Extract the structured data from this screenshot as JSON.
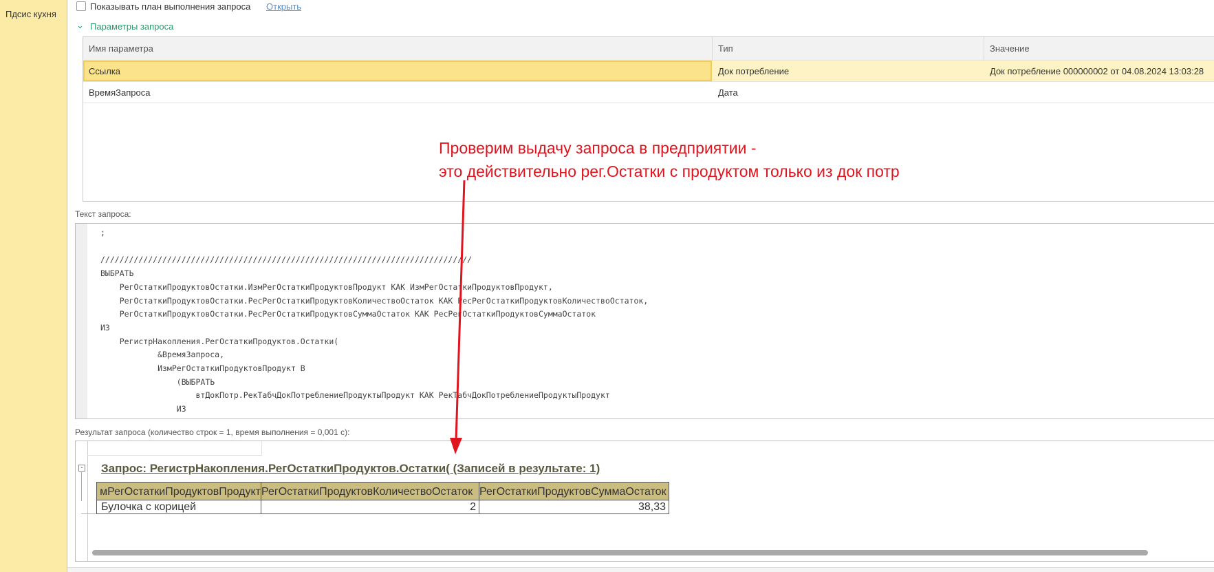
{
  "sidebar": {
    "item": "Пдсис кухня"
  },
  "plan": {
    "checkbox_label": "Показывать план выполнения запроса",
    "open_link": "Открыть"
  },
  "params": {
    "section_title": "Параметры запроса",
    "columns": [
      "Имя параметра",
      "Тип",
      "Значение"
    ],
    "rows": [
      [
        "Ссылка",
        "Док потребление",
        "Док потребление 000000002 от 04.08.2024 13:03:28"
      ],
      [
        "ВремяЗапроса",
        "Дата",
        ""
      ]
    ]
  },
  "query": {
    "label": "Текст запроса:",
    "text": ";\n\n//////////////////////////////////////////////////////////////////////////////\nВЫБРАТЬ\n    РегОстаткиПродуктовОстатки.ИзмРегОстаткиПродуктовПродукт КАК ИзмРегОстаткиПродуктовПродукт,\n    РегОстаткиПродуктовОстатки.РесРегОстаткиПродуктовКоличествоОстаток КАК РесРегОстаткиПродуктовКоличествоОстаток,\n    РегОстаткиПродуктовОстатки.РесРегОстаткиПродуктовСуммаОстаток КАК РесРегОстаткиПродуктовСуммаОстаток\nИЗ\n    РегистрНакопления.РегОстаткиПродуктов.Остатки(\n            &ВремяЗапроса,\n            ИзмРегОстаткиПродуктовПродукт В\n                (ВЫБРАТЬ\n                    втДокПотр.РекТабчДокПотреблениеПродуктыПродукт КАК РекТабчДокПотреблениеПродуктыПродукт\n                ИЗ\n                    втДокПотр КАК втДокПотр)) КАК РегОстаткиПродуктовОстатки"
  },
  "result": {
    "label": "Результат запроса (количество строк = 1, время выполнения = 0,001 с):",
    "title": "Запрос: РегистрНакопления.РегОстаткиПродуктов.Остатки( (Записей в результате: 1)",
    "columns": [
      "мРегОстаткиПродуктовПродукт",
      "РегОстаткиПродуктовКоличествоОстаток",
      "РегОстаткиПродуктовСуммаОстаток"
    ],
    "rows": [
      [
        "Булочка с корицей",
        "2",
        "38,33"
      ]
    ]
  },
  "annotation": {
    "line1": "Проверим выдачу запроса в предприятии -",
    "line2": "это действительно рег.Остатки с продуктом только из док потр",
    "color": "#e0141e"
  }
}
